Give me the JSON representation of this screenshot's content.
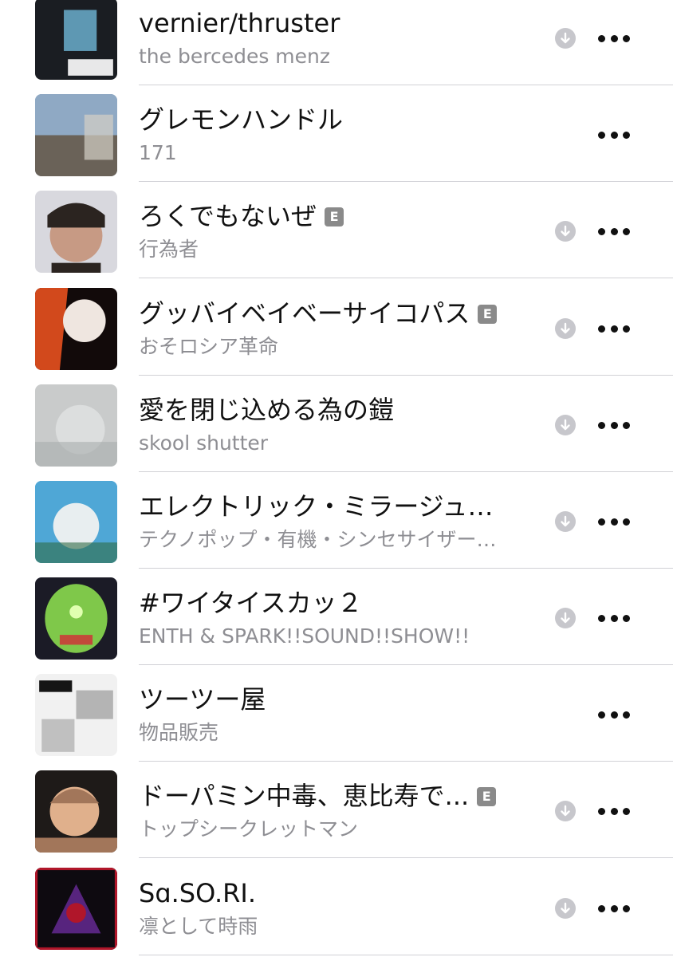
{
  "songs": [
    {
      "title": "vernier/thruster",
      "artist": "the bercedes menz",
      "explicit": false,
      "downloaded": true,
      "art_colors": [
        "#1a1d22",
        "#6fb8d8",
        "#ffffff"
      ]
    },
    {
      "title": "グレモンハンドル",
      "artist": "171",
      "explicit": false,
      "downloaded": false,
      "art_colors": [
        "#8fa9c4",
        "#6a6258",
        "#d4d0c6"
      ]
    },
    {
      "title": "ろくでもないぜ",
      "artist": "行為者",
      "explicit": true,
      "downloaded": true,
      "art_colors": [
        "#d8d8de",
        "#2b2420",
        "#c79a84"
      ]
    },
    {
      "title": "グッバイベイベーサイコパス",
      "artist": "おそロシア革命",
      "explicit": true,
      "downloaded": true,
      "art_colors": [
        "#120a0a",
        "#d2491c",
        "#efe6e0"
      ]
    },
    {
      "title": "愛を閉じ込める為の鎧",
      "artist": "skool shutter",
      "explicit": false,
      "downloaded": true,
      "art_colors": [
        "#c9cbcb",
        "#a9adad",
        "#e4e5e5"
      ]
    },
    {
      "title": "エレクトリック・ミラージュ…",
      "artist": "テクノポップ・有機・シンセサイザー…",
      "explicit": false,
      "downloaded": true,
      "art_colors": [
        "#4fa7d6",
        "#e8eef0",
        "#2e6a44"
      ]
    },
    {
      "title": "#ワイタイスカッ２",
      "artist": "ENTH & SPARK!!SOUND!!SHOW!!",
      "explicit": false,
      "downloaded": true,
      "art_colors": [
        "#1b1b26",
        "#7fc84a",
        "#c24a3a"
      ]
    },
    {
      "title": "ツーツー屋",
      "artist": "物品販売",
      "explicit": false,
      "downloaded": false,
      "art_colors": [
        "#f1f1f1",
        "#151515",
        "#b4b4b4"
      ]
    },
    {
      "title": "ドーパミン中毒、恵比寿で...",
      "artist": "トップシークレットマン",
      "explicit": true,
      "downloaded": true,
      "art_colors": [
        "#1e1a18",
        "#a2765a",
        "#e0b08c"
      ]
    },
    {
      "title": "Sɑ.SO.RI.",
      "artist": "凛として時雨",
      "explicit": false,
      "downloaded": true,
      "art_colors": [
        "#0e0a10",
        "#b0162a",
        "#6a2a9a"
      ]
    }
  ]
}
